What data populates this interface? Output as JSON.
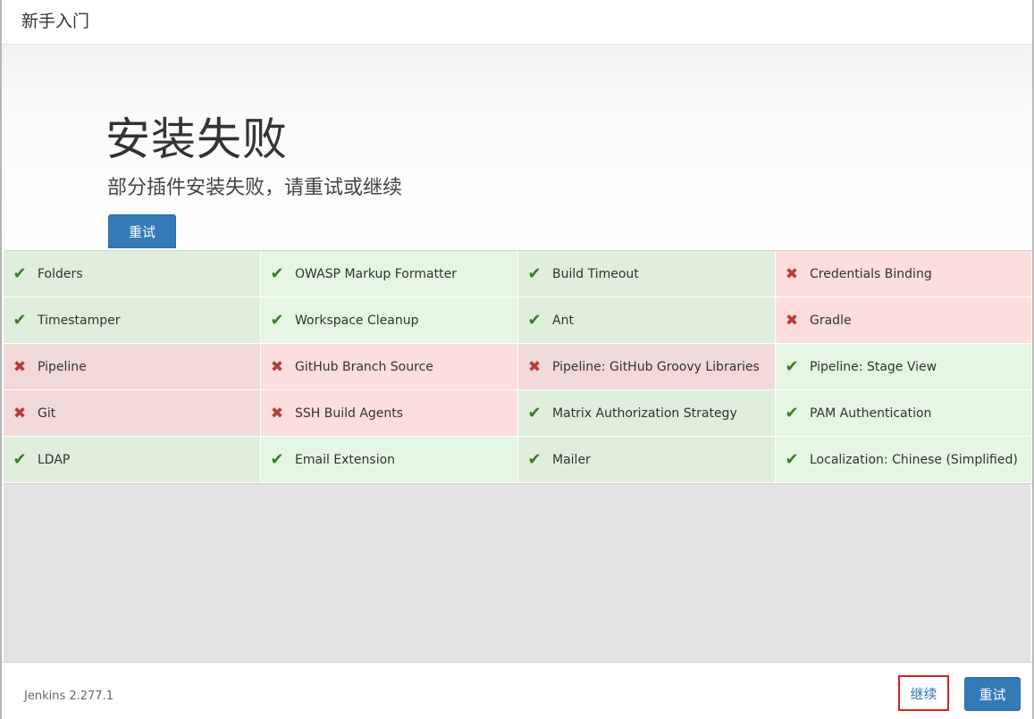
{
  "window": {
    "title": "新手入门"
  },
  "hero": {
    "heading": "安装失败",
    "subtitle": "部分插件安装失败，请重试或继续",
    "retry_label": "重试"
  },
  "plugins": [
    {
      "name": "Folders",
      "status": "success"
    },
    {
      "name": "OWASP Markup Formatter",
      "status": "success"
    },
    {
      "name": "Build Timeout",
      "status": "success"
    },
    {
      "name": "Credentials Binding",
      "status": "fail"
    },
    {
      "name": "Timestamper",
      "status": "success"
    },
    {
      "name": "Workspace Cleanup",
      "status": "success"
    },
    {
      "name": "Ant",
      "status": "success"
    },
    {
      "name": "Gradle",
      "status": "fail"
    },
    {
      "name": "Pipeline",
      "status": "fail"
    },
    {
      "name": "GitHub Branch Source",
      "status": "fail"
    },
    {
      "name": "Pipeline: GitHub Groovy Libraries",
      "status": "fail"
    },
    {
      "name": "Pipeline: Stage View",
      "status": "success"
    },
    {
      "name": "Git",
      "status": "fail"
    },
    {
      "name": "SSH Build Agents",
      "status": "fail"
    },
    {
      "name": "Matrix Authorization Strategy",
      "status": "success"
    },
    {
      "name": "PAM Authentication",
      "status": "success"
    },
    {
      "name": "LDAP",
      "status": "success"
    },
    {
      "name": "Email Extension",
      "status": "success"
    },
    {
      "name": "Mailer",
      "status": "success"
    },
    {
      "name": "Localization: Chinese (Simplified)",
      "status": "success"
    }
  ],
  "icons": {
    "success": "check-icon",
    "fail": "cross-icon"
  },
  "colors": {
    "primary": "#337ab7",
    "success_bg": "#e5f7e2",
    "fail_bg": "#fcdede",
    "highlight_border": "#e02020"
  },
  "footer": {
    "version": "Jenkins 2.277.1",
    "continue_label": "继续",
    "retry_label": "重试"
  }
}
